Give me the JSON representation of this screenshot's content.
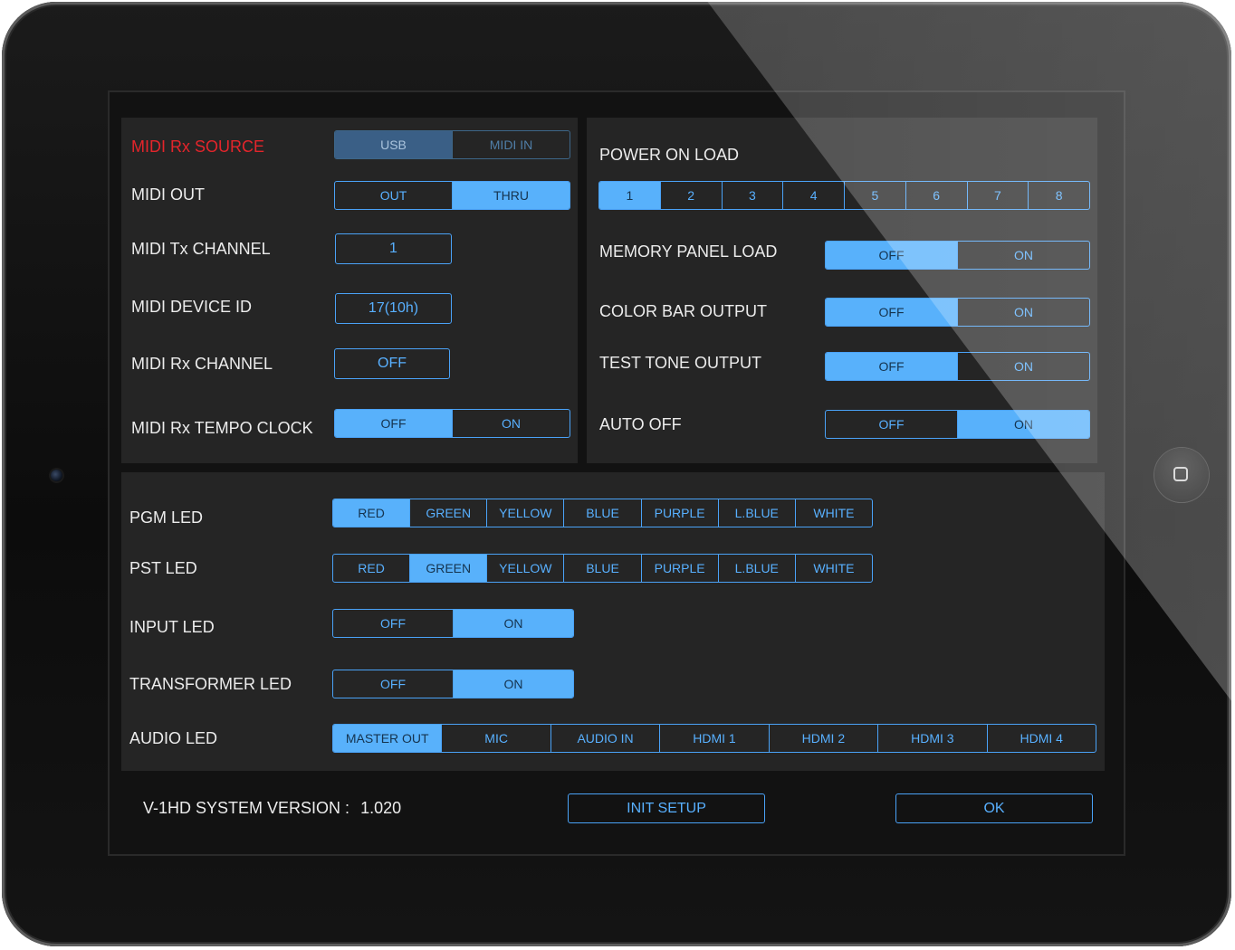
{
  "midi": {
    "rx_source": {
      "label": "MIDI Rx SOURCE",
      "options": [
        "USB",
        "MIDI IN"
      ],
      "selected": 0
    },
    "out": {
      "label": "MIDI OUT",
      "options": [
        "OUT",
        "THRU"
      ],
      "selected": 1
    },
    "tx_channel": {
      "label": "MIDI Tx CHANNEL",
      "value": "1"
    },
    "device_id": {
      "label": "MIDI DEVICE ID",
      "value": "17(10h)"
    },
    "rx_channel": {
      "label": "MIDI Rx CHANNEL",
      "value": "OFF"
    },
    "rx_tempo_clock": {
      "label": "MIDI Rx TEMPO CLOCK",
      "options": [
        "OFF",
        "ON"
      ],
      "selected": 0
    }
  },
  "system": {
    "power_on_load": {
      "label": "POWER ON LOAD",
      "options": [
        "1",
        "2",
        "3",
        "4",
        "5",
        "6",
        "7",
        "8"
      ],
      "selected": 0
    },
    "memory_panel_load": {
      "label": "MEMORY PANEL LOAD",
      "options": [
        "OFF",
        "ON"
      ],
      "selected": 0
    },
    "color_bar_output": {
      "label": "COLOR BAR OUTPUT",
      "options": [
        "OFF",
        "ON"
      ],
      "selected": 0
    },
    "test_tone_output": {
      "label": "TEST TONE OUTPUT",
      "options": [
        "OFF",
        "ON"
      ],
      "selected": 0
    },
    "auto_off": {
      "label": "AUTO OFF",
      "options": [
        "OFF",
        "ON"
      ],
      "selected": 1
    }
  },
  "leds": {
    "pgm": {
      "label": "PGM LED",
      "options": [
        "RED",
        "GREEN",
        "YELLOW",
        "BLUE",
        "PURPLE",
        "L.BLUE",
        "WHITE"
      ],
      "selected": 0
    },
    "pst": {
      "label": "PST LED",
      "options": [
        "RED",
        "GREEN",
        "YELLOW",
        "BLUE",
        "PURPLE",
        "L.BLUE",
        "WHITE"
      ],
      "selected": 1
    },
    "input": {
      "label": "INPUT LED",
      "options": [
        "OFF",
        "ON"
      ],
      "selected": 1
    },
    "transformer": {
      "label": "TRANSFORMER LED",
      "options": [
        "OFF",
        "ON"
      ],
      "selected": 1
    },
    "audio": {
      "label": "AUDIO LED",
      "options": [
        "MASTER OUT",
        "MIC",
        "AUDIO IN",
        "HDMI 1",
        "HDMI 2",
        "HDMI 3",
        "HDMI 4"
      ],
      "selected": 0
    }
  },
  "footer": {
    "version_label": "V-1HD SYSTEM VERSION :",
    "version_value": "1.020",
    "init_setup": "INIT SETUP",
    "ok": "OK"
  },
  "colors": {
    "accent": "#58b1fb",
    "label_red": "#e4252b",
    "panel": "#252525",
    "screen": "#121212"
  }
}
